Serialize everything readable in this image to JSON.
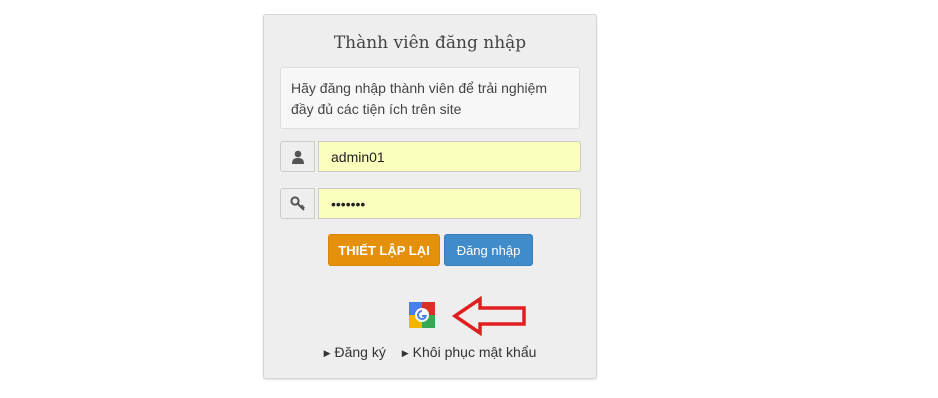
{
  "login_panel": {
    "title": "Thành viên đăng nhập",
    "info_text": "Hãy đăng nhập thành viên để trải nghiệm đầy đủ các tiện ích trên site",
    "username": {
      "value": "admin01",
      "icon": "user-icon"
    },
    "password": {
      "value": "•••••••",
      "icon": "key-icon"
    },
    "reset_button": "THIẾT LẬP LẠI",
    "login_button": "Đăng nhập",
    "google_icon": "google-login-icon",
    "links": {
      "register": "Đăng ký",
      "recover": "Khôi phục mật khẩu"
    }
  },
  "colors": {
    "reset_button": "#e5900b",
    "login_button": "#428bca",
    "autofill_bg": "#faffbd",
    "arrow": "#e02020"
  }
}
